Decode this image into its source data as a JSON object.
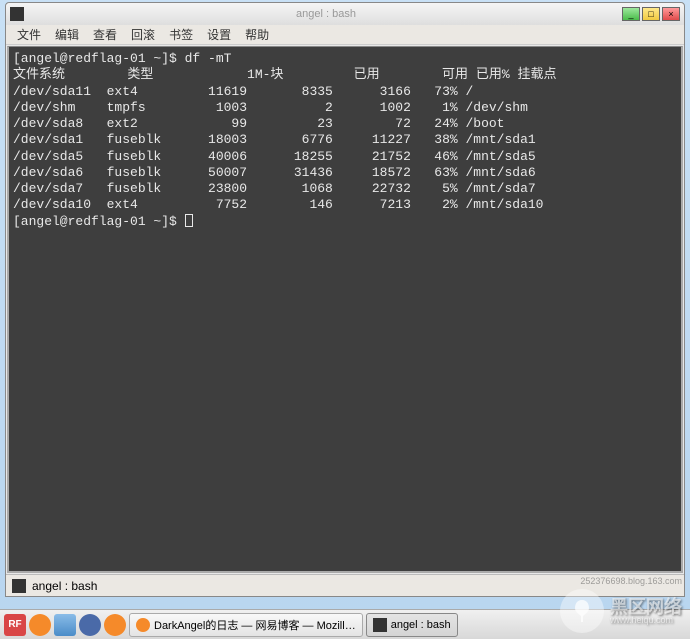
{
  "window": {
    "title": "angel : bash",
    "controls": {
      "min": "_",
      "max": "□",
      "close": "×"
    }
  },
  "menubar": [
    "文件",
    "编辑",
    "查看",
    "回滚",
    "书签",
    "设置",
    "帮助"
  ],
  "terminal": {
    "prompt1": "[angel@redflag-01 ~]$ ",
    "command": "df -mT",
    "headers": {
      "fs": "文件系统",
      "type": "类型",
      "blocks": "1M-块",
      "used": "已用",
      "avail": "可用",
      "usepct": "已用%",
      "mount": "挂载点"
    },
    "rows": [
      {
        "fs": "/dev/sda11",
        "type": "ext4",
        "blocks": "11619",
        "used": "8335",
        "avail": "3166",
        "pct": "73%",
        "mount": "/"
      },
      {
        "fs": "/dev/shm",
        "type": "tmpfs",
        "blocks": "1003",
        "used": "2",
        "avail": "1002",
        "pct": "1%",
        "mount": "/dev/shm"
      },
      {
        "fs": "/dev/sda8",
        "type": "ext2",
        "blocks": "99",
        "used": "23",
        "avail": "72",
        "pct": "24%",
        "mount": "/boot"
      },
      {
        "fs": "/dev/sda1",
        "type": "fuseblk",
        "blocks": "18003",
        "used": "6776",
        "avail": "11227",
        "pct": "38%",
        "mount": "/mnt/sda1"
      },
      {
        "fs": "/dev/sda5",
        "type": "fuseblk",
        "blocks": "40006",
        "used": "18255",
        "avail": "21752",
        "pct": "46%",
        "mount": "/mnt/sda5"
      },
      {
        "fs": "/dev/sda6",
        "type": "fuseblk",
        "blocks": "50007",
        "used": "31436",
        "avail": "18572",
        "pct": "63%",
        "mount": "/mnt/sda6"
      },
      {
        "fs": "/dev/sda7",
        "type": "fuseblk",
        "blocks": "23800",
        "used": "1068",
        "avail": "22732",
        "pct": "5%",
        "mount": "/mnt/sda7"
      },
      {
        "fs": "/dev/sda10",
        "type": "ext4",
        "blocks": "7752",
        "used": "146",
        "avail": "7213",
        "pct": "2%",
        "mount": "/mnt/sda10"
      }
    ],
    "prompt2": "[angel@redflag-01 ~]$ "
  },
  "statusbar": {
    "text": "angel : bash"
  },
  "taskbar": {
    "launcher_rf": "RF",
    "items": [
      {
        "label": "DarkAngel的日志 — 网易博客 — Mozill…"
      },
      {
        "label": "angel : bash"
      }
    ]
  },
  "watermark": {
    "main": "黑区网络",
    "sub": "www.heiqu.com"
  },
  "blog_id": "252376698.blog.163.com"
}
